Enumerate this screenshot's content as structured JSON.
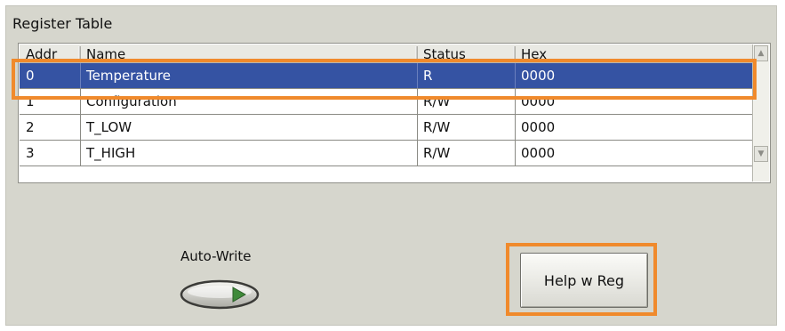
{
  "panel": {
    "title": "Register Table"
  },
  "table": {
    "columns": [
      "Addr",
      "Name",
      "Status",
      "Hex"
    ],
    "rows": [
      {
        "addr": "0",
        "name": "Temperature",
        "status": "R",
        "hex": "0000",
        "selected": true
      },
      {
        "addr": "1",
        "name": "Configuration",
        "status": "R/W",
        "hex": "0000",
        "selected": false
      },
      {
        "addr": "2",
        "name": "T_LOW",
        "status": "R/W",
        "hex": "0000",
        "selected": false
      },
      {
        "addr": "3",
        "name": "T_HIGH",
        "status": "R/W",
        "hex": "0000",
        "selected": false
      }
    ],
    "scrollbar": {
      "up_icon": "triangle-up-icon",
      "down_icon": "triangle-down-icon"
    }
  },
  "auto_write": {
    "label": "Auto-Write",
    "state": "off",
    "indicator_icon": "triangle-right-icon"
  },
  "help_button": {
    "label": "Help w Reg"
  },
  "colors": {
    "selection": "#3553a3",
    "highlight_box": "#f08a2c",
    "panel_bg": "#d6d6cd",
    "toggle_indicator": "#3f8a3a"
  }
}
